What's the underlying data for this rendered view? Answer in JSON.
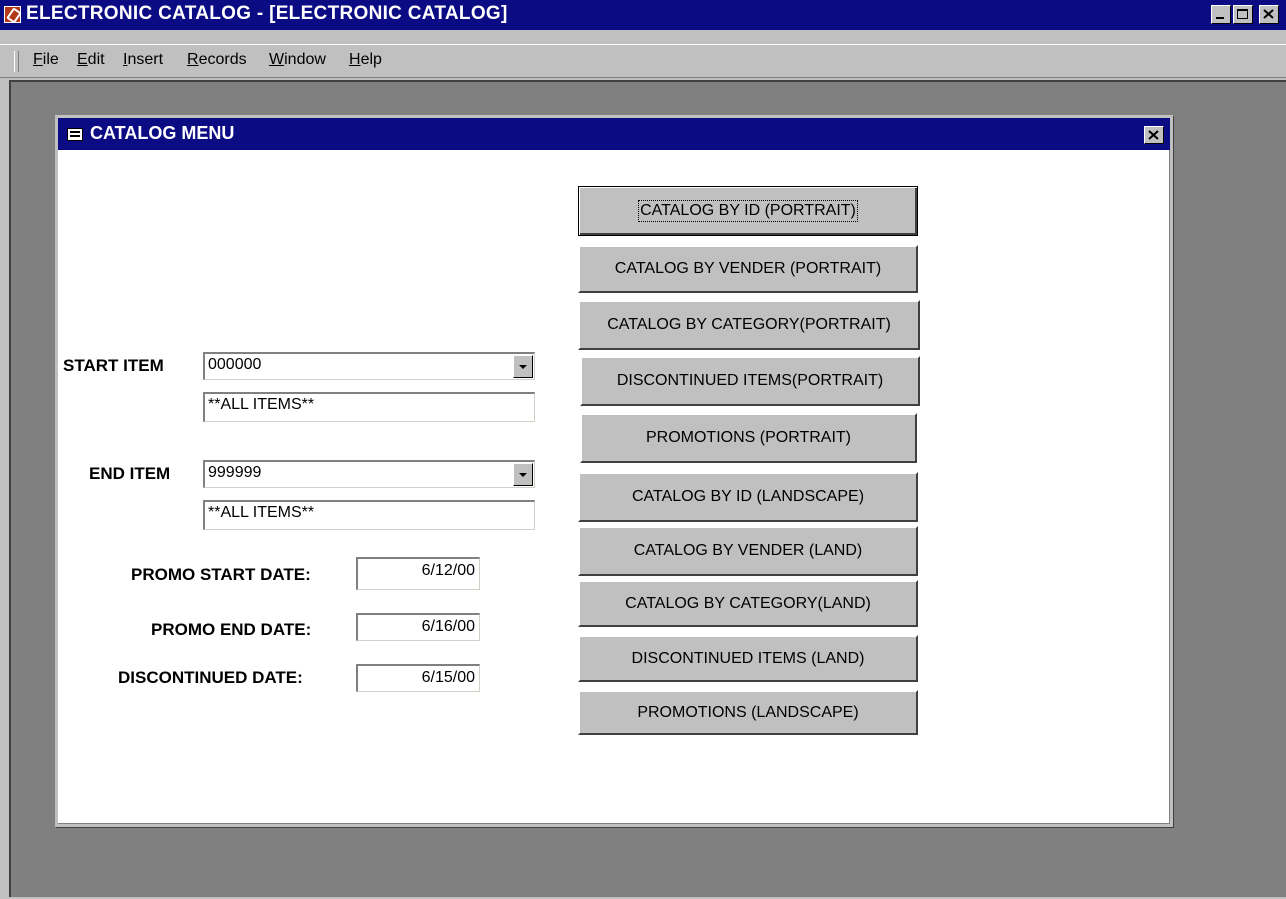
{
  "app": {
    "title": "ELECTRONIC CATALOG - [ELECTRONIC CATALOG]"
  },
  "menu": {
    "items": [
      {
        "underline": "F",
        "rest": "ile"
      },
      {
        "underline": "E",
        "rest": "dit"
      },
      {
        "underline": "I",
        "rest": "nsert"
      },
      {
        "underline": "R",
        "rest": "ecords"
      },
      {
        "underline": "W",
        "rest": "indow"
      },
      {
        "underline": "H",
        "rest": "elp"
      }
    ]
  },
  "form": {
    "title": "CATALOG MENU",
    "start_item_label": "START ITEM",
    "start_item_value": "000000",
    "start_item_desc": "**ALL ITEMS**",
    "end_item_label": "END ITEM",
    "end_item_value": "999999",
    "end_item_desc": "**ALL ITEMS**",
    "promo_start_label": "PROMO START DATE:",
    "promo_start_value": "6/12/00",
    "promo_end_label": "PROMO END DATE:",
    "promo_end_value": "6/16/00",
    "discontinued_label": "DISCONTINUED DATE:",
    "discontinued_value": "6/15/00"
  },
  "buttons": [
    "CATALOG BY ID (PORTRAIT)",
    "CATALOG BY VENDER (PORTRAIT)",
    "CATALOG BY CATEGORY(PORTRAIT)",
    "DISCONTINUED ITEMS(PORTRAIT)",
    "PROMOTIONS (PORTRAIT)",
    "CATALOG BY ID (LANDSCAPE)",
    "CATALOG BY VENDER (LAND)",
    "CATALOG BY CATEGORY(LAND)",
    "DISCONTINUED ITEMS (LAND)",
    "PROMOTIONS (LANDSCAPE)"
  ],
  "colors": {
    "titlebar": "#0b0b84",
    "face": "#c0c0c0",
    "mdi_background": "#808080"
  }
}
